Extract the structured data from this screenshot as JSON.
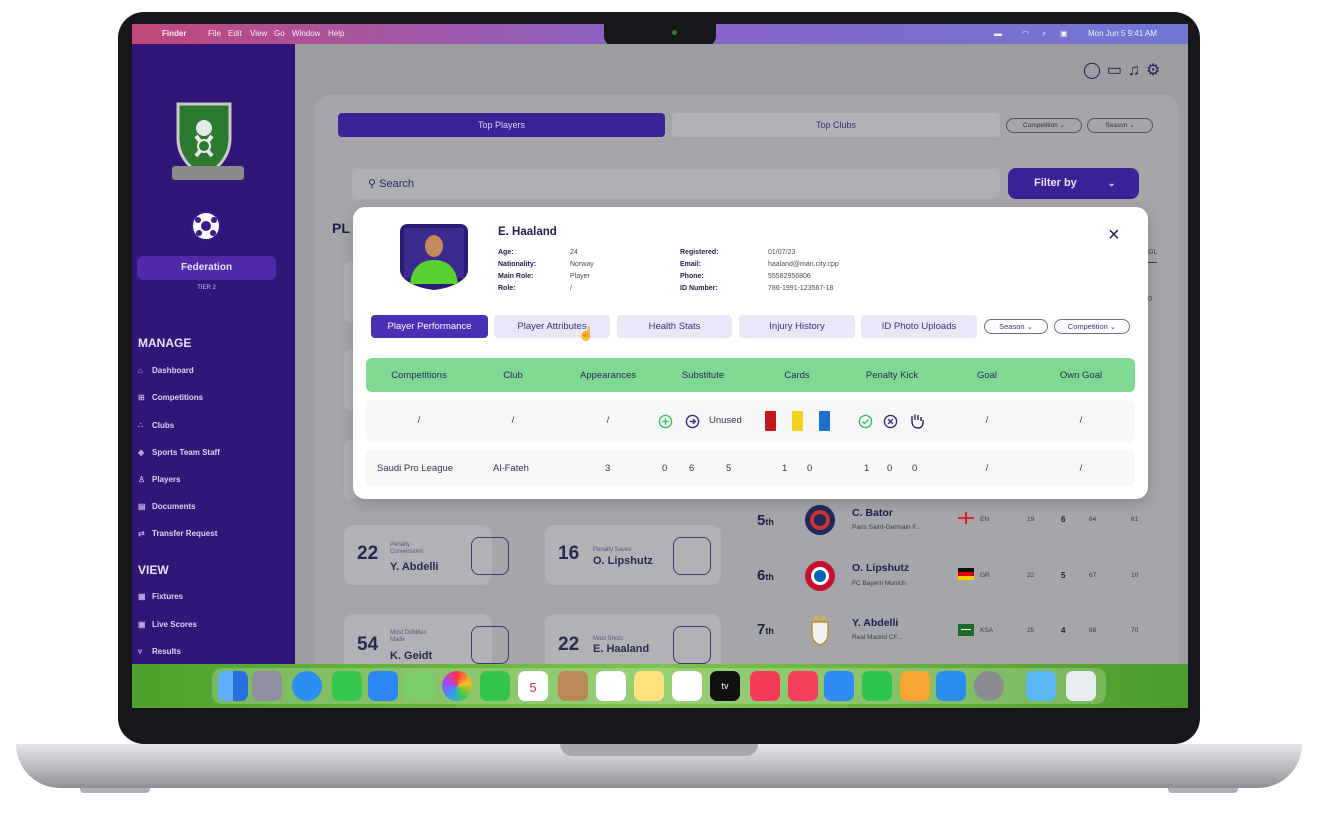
{
  "menubar": {
    "apple": "",
    "items": [
      "Finder",
      "File",
      "Edit",
      "View",
      "Go",
      "Window",
      "Help"
    ],
    "clock": "Mon Jun 5 9:41 AM"
  },
  "sidebar": {
    "federation_label": "Federation",
    "tier": "TIER 2",
    "manage_title": "MANAGE",
    "manage_items": [
      {
        "label": "Dashboard",
        "icon": "home-icon"
      },
      {
        "label": "Competitions",
        "icon": "bracket-icon"
      },
      {
        "label": "Clubs",
        "icon": "clubs-icon"
      },
      {
        "label": "Sports Team Staff",
        "icon": "shield-icon"
      },
      {
        "label": "Players",
        "icon": "jersey-icon"
      },
      {
        "label": "Documents",
        "icon": "documents-icon"
      },
      {
        "label": "Transfer Request",
        "icon": "transfer-icon"
      }
    ],
    "view_title": "VIEW",
    "view_items": [
      {
        "label": "Fixtures",
        "icon": "fixtures-icon"
      },
      {
        "label": "Live Scores",
        "icon": "scores-icon"
      },
      {
        "label": "Results",
        "icon": "results-icon"
      }
    ]
  },
  "main": {
    "tabs": [
      "Top Players",
      "Top Clubs"
    ],
    "filters": [
      "Competition ⌄",
      "Season ⌄"
    ],
    "search_placeholder": "Search",
    "filter_button": "Filter by",
    "section_heading_fragment": "PL",
    "column_fragment": "GL",
    "value_fragment": "0",
    "cards": [
      {
        "number": "22",
        "small": "Penalty\nConversions",
        "name": "Y. Abdelli"
      },
      {
        "number": "16",
        "small": "Penalty Saves",
        "name": "O. Lipshutz"
      },
      {
        "number": "54",
        "small": "Most Dribbles\nMade",
        "name": "K. Geidt"
      },
      {
        "number": "22",
        "small": "Most Shots",
        "name": "E. Haaland"
      }
    ],
    "ranking": [
      {
        "rank": "5",
        "suffix": "th",
        "name": "C. Bator",
        "club": "Paris Saint-Germain F...",
        "country": "EN",
        "a": "19",
        "b": "6",
        "c": "84",
        "d": "61"
      },
      {
        "rank": "6",
        "suffix": "th",
        "name": "O. Lipshutz",
        "club": "FC Bayern Munich",
        "country": "GR",
        "a": "22",
        "b": "5",
        "c": "67",
        "d": "10"
      },
      {
        "rank": "7",
        "suffix": "th",
        "name": "Y. Abdelli",
        "club": "Real Madrid CF...",
        "country": "KSA",
        "a": "25",
        "b": "4",
        "c": "88",
        "d": "70"
      }
    ]
  },
  "modal": {
    "name": "E. Haaland",
    "left_fields": [
      {
        "label": "Age:",
        "value": "24"
      },
      {
        "label": "Nationality:",
        "value": "Norway"
      },
      {
        "label": "Main Role:",
        "value": "Player"
      },
      {
        "label": "Role:",
        "value": "/"
      }
    ],
    "right_fields": [
      {
        "label": "Registered:",
        "value": "01/07/23"
      },
      {
        "label": "Email:",
        "value": "haaland@man.city.cpp"
      },
      {
        "label": "Phone:",
        "value": "55582956806"
      },
      {
        "label": "ID Number:",
        "value": "786-1991-123567-18"
      }
    ],
    "close": "×",
    "tabs": [
      "Player Performance",
      "Player Attributes",
      "Health Stats",
      "Injury History",
      "ID Photo Uploads"
    ],
    "pills": [
      "Season ⌄",
      "Competition ⌄"
    ],
    "columns": [
      "Competitions",
      "Club",
      "Appearances",
      "Substitute",
      "Cards",
      "Penalty Kick",
      "Goal",
      "Own Goal"
    ],
    "legend_row": {
      "competitions": "/",
      "club": "/",
      "appearances": "/",
      "unused": "Unused",
      "goal": "/",
      "own_goal": "/"
    },
    "data_row": {
      "competition": "Saudi Pro League",
      "club": "Al-Fateh",
      "appearances": "3",
      "sub_in": "0",
      "sub_out": "6",
      "unused": "5",
      "red": "1",
      "yellow": "0",
      "pk_scored": "1",
      "pk_missed": "0",
      "pk_saved": "0",
      "goal": "/",
      "own_goal": "/"
    },
    "colors": {
      "accent": "#4a30b5",
      "header_green": "#7fd992",
      "red_card": "#c0181f",
      "yellow_card": "#f4d21c",
      "blue_card": "#1f6fd1"
    }
  },
  "topbar_icons": [
    "chat-icon",
    "calendar-icon",
    "bell-icon",
    "settings-icon"
  ],
  "dock_icons": [
    "finder",
    "launchpad",
    "safari",
    "messages",
    "mail",
    "maps",
    "photos",
    "facetime",
    "calendar",
    "contacts",
    "reminders",
    "notes",
    "freeform",
    "tv",
    "music",
    "news",
    "keynote",
    "numbers",
    "pages",
    "app-store",
    "system-settings",
    "downloads",
    "trash"
  ]
}
